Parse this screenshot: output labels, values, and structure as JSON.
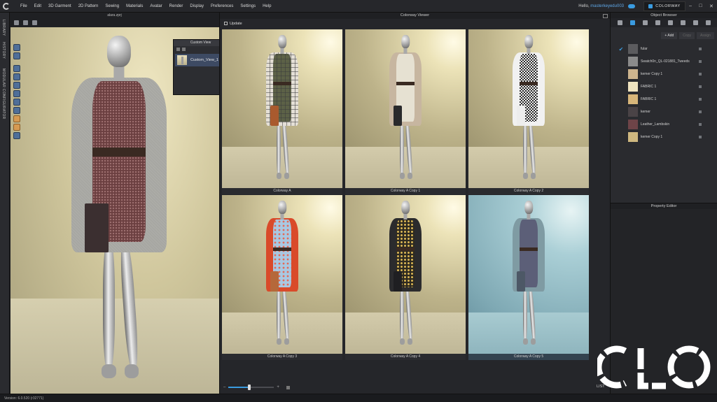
{
  "menu": [
    "File",
    "Edit",
    "3D Garment",
    "2D Pattern",
    "Sewing",
    "Materials",
    "Avatar",
    "Render",
    "Display",
    "Preferences",
    "Settings",
    "Help"
  ],
  "user": {
    "greeting": "Hello,",
    "name": "masterkeyedu003"
  },
  "mode": "COLORWAY",
  "left_tabs": [
    "LIBRARY",
    "HISTORY",
    "MODULAR CONFIGURATOR"
  ],
  "window3d": {
    "title": "alara.zprj"
  },
  "custom_view": {
    "title": "Custom View",
    "item": "Custom_View_1"
  },
  "colorway": {
    "title": "Colorway Viewer",
    "update_label": "Update",
    "tiles": [
      {
        "label": "Colorway A",
        "coat": "#e4dfd6",
        "dress": "#5c6147",
        "bag": "#a95a2e",
        "pattern": "plaid"
      },
      {
        "label": "Colorway A Copy 1",
        "coat": "#c7b6a0",
        "dress": "#e6e1d2",
        "bag": "#2a2a2c",
        "pattern": "plain"
      },
      {
        "label": "Colorway A Copy 2",
        "coat": "#f1f1f1",
        "dress": "#3b3b3b",
        "bag": "#ededed",
        "pattern": "check"
      },
      {
        "label": "Colorway A Copy 3",
        "coat": "#d94a2a",
        "dress": "#a9c8e2",
        "bag": "#b5683a",
        "pattern": "floral"
      },
      {
        "label": "Colorway A Copy 4",
        "coat": "#2b2b2d",
        "dress": "#2e2a20",
        "bag": "#1f1f22",
        "pattern": "floral-dark"
      },
      {
        "label": "Colorway A Copy 5",
        "coat": "#7f9ba3",
        "dress": "#5c5f78",
        "bag": "#4d5866",
        "pattern": "plain"
      }
    ],
    "list_label": "LIST"
  },
  "object_browser": {
    "title": "Object Browser",
    "actions": [
      "+ Add",
      "Copy",
      "Assign"
    ],
    "fabrics": [
      {
        "name": "fular",
        "color": "#5b5b5e",
        "checked": true
      },
      {
        "name": "Swatch0n_QL-021881_Tweeds",
        "color": "#8b8b8b",
        "checked": false
      },
      {
        "name": "kemer Copy 1",
        "color": "#cdb48e",
        "checked": false
      },
      {
        "name": "FABRIC 1",
        "color": "#efe4c0",
        "checked": false
      },
      {
        "name": "FABRIC 1",
        "color": "#d8b67a",
        "checked": false
      },
      {
        "name": "kemer",
        "color": "#4a4346",
        "checked": false
      },
      {
        "name": "Leather_Lambskin",
        "color": "#6e4448",
        "checked": false
      },
      {
        "name": "kemer Copy 1",
        "color": "#cfb880",
        "checked": false
      }
    ]
  },
  "property_editor": {
    "title": "Property Editor"
  },
  "zoom": {
    "level": 0.45
  },
  "status": "Version: 6.0.520 (r32771)",
  "colors": {
    "accent": "#3a9be0",
    "selected_tile": "#33424f"
  }
}
